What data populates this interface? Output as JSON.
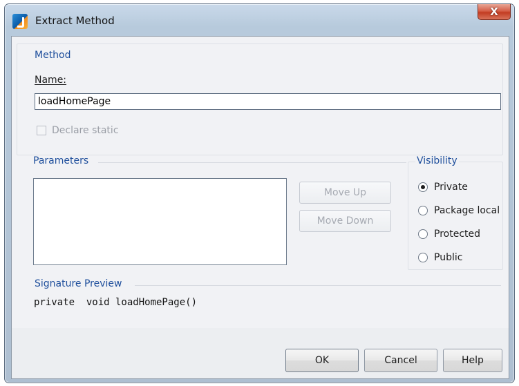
{
  "window": {
    "title": "Extract Method",
    "close_glyph": "X"
  },
  "method_group": {
    "label": "Method",
    "name_label": "Name:",
    "name_value": "loadHomePage",
    "declare_static_label": "Declare static",
    "declare_static_checked": false
  },
  "parameters_group": {
    "label": "Parameters",
    "move_up_label": "Move Up",
    "move_down_label": "Move Down"
  },
  "visibility_group": {
    "label": "Visibility",
    "options": [
      {
        "label": "Private",
        "selected": true
      },
      {
        "label": "Package local",
        "selected": false
      },
      {
        "label": "Protected",
        "selected": false
      },
      {
        "label": "Public",
        "selected": false
      }
    ]
  },
  "signature_group": {
    "label": "Signature Preview",
    "text": "private  void loadHomePage()"
  },
  "buttons": {
    "ok": "OK",
    "cancel": "Cancel",
    "help": "Help"
  },
  "colors": {
    "group_label": "#1f4f9c",
    "dialog_bg": "#f1f2f5"
  },
  "icons": {
    "app": "intellij-idea-icon",
    "close": "close-icon"
  }
}
